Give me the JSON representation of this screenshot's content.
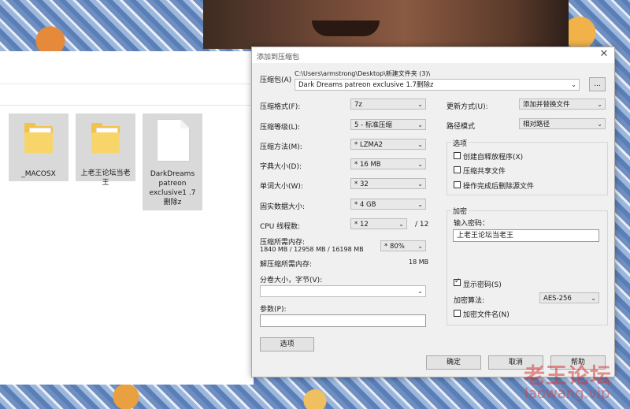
{
  "window_title": "添加到压缩包",
  "archive": {
    "label": "压缩包(A)",
    "path": "C:\\Users\\armstrong\\Desktop\\新建文件夹 (3)\\",
    "name": "Dark Dreams patreon exclusive 1.7删除z",
    "browse_label": "..."
  },
  "left_fields": [
    {
      "label": "压缩格式(F):",
      "value": "7z"
    },
    {
      "label": "压缩等级(L):",
      "value": "5 - 标准压缩"
    },
    {
      "label": "压缩方法(M):",
      "value": "* LZMA2"
    },
    {
      "label": "字典大小(D):",
      "value": "* 16 MB"
    },
    {
      "label": "单词大小(W):",
      "value": "* 32"
    },
    {
      "label": "固实数据大小:",
      "value": "* 4 GB"
    }
  ],
  "cpu": {
    "label": "CPU 线程数:",
    "value": "* 12",
    "total": "/ 12"
  },
  "memory": {
    "compress_label": "压缩所需内存:",
    "compress_value": "1840 MB / 12958 MB / 16198 MB",
    "percent": "* 80%",
    "decompress_label": "解压缩所需内存:",
    "decompress_value": "18 MB"
  },
  "split": {
    "label": "分卷大小，字节(V):",
    "value": ""
  },
  "params": {
    "label": "参数(P):",
    "value": ""
  },
  "options_button": "选项",
  "update": {
    "label": "更新方式(U):",
    "value": "添加并替换文件"
  },
  "path_mode": {
    "label": "路径模式",
    "value": "相对路径"
  },
  "options_group": {
    "title": "选项",
    "items": [
      {
        "label": "创建自释放程序(X)",
        "checked": false
      },
      {
        "label": "压缩共享文件",
        "checked": false
      },
      {
        "label": "操作完成后删除源文件",
        "checked": false
      }
    ]
  },
  "encryption": {
    "title": "加密",
    "password_label": "输入密码：",
    "password": "上老王论坛当老王",
    "show_password": "显示密码(S)",
    "method_label": "加密算法:",
    "method_value": "AES-256",
    "encrypt_names": "加密文件名(N)"
  },
  "buttons": {
    "ok": "确定",
    "cancel": "取消",
    "help": "帮助"
  },
  "files": [
    {
      "name": "_MACOSX"
    },
    {
      "name": "上老王论坛当老王"
    },
    {
      "name": "DarkDreams patreon exclusive1 .7删除z"
    }
  ],
  "watermark": {
    "cn": "老王论坛",
    "en": "laowang.vip"
  }
}
